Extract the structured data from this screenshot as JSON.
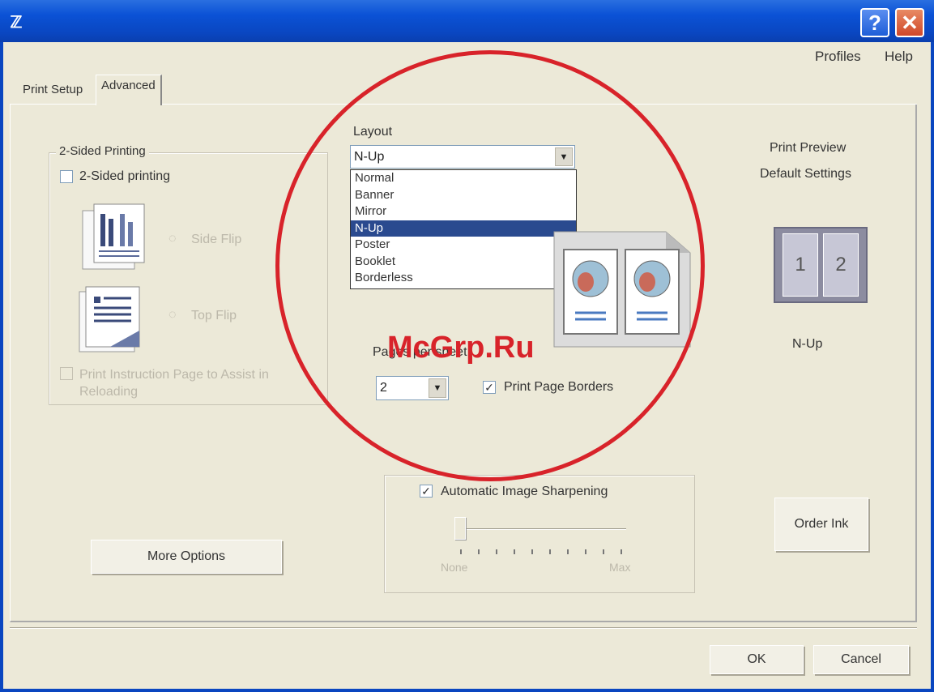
{
  "window": {
    "help_glyph": "?",
    "close_glyph": "✕",
    "app_glyph": "ℤ"
  },
  "menu": {
    "profiles": "Profiles",
    "help": "Help"
  },
  "tabs": [
    {
      "label": "Print Setup"
    },
    {
      "label": "Advanced"
    }
  ],
  "two_sided": {
    "legend": "2-Sided Printing",
    "checkbox_label": "2-Sided printing",
    "checked": false,
    "side_flip_label": "Side Flip",
    "top_flip_label": "Top Flip",
    "instruction_label_line1": "Print Instruction Page to Assist in",
    "instruction_label_line2": "Reloading"
  },
  "layout": {
    "label": "Layout",
    "selected": "N-Up",
    "options": [
      "Normal",
      "Banner",
      "Mirror",
      "N-Up",
      "Poster",
      "Booklet",
      "Borderless"
    ],
    "pages_per_sheet_label": "Pages per sheet",
    "pages_per_sheet_value": "2",
    "print_page_borders_label": "Print Page Borders",
    "print_page_borders_checked": true
  },
  "preview": {
    "title": "Print Preview",
    "subtitle": "Default Settings",
    "page_1": "1",
    "page_2": "2",
    "caption": "N-Up"
  },
  "sharpening": {
    "label": "Automatic Image Sharpening",
    "checked": true,
    "min_label": "None",
    "max_label": "Max"
  },
  "buttons": {
    "more_options": "More Options",
    "order_ink": "Order Ink",
    "ok": "OK",
    "cancel": "Cancel"
  },
  "watermark": "McGrp.Ru",
  "colors": {
    "title_bar": "#0a46c0",
    "highlight": "#2a4a8f",
    "annotation_red": "#d8232a"
  }
}
